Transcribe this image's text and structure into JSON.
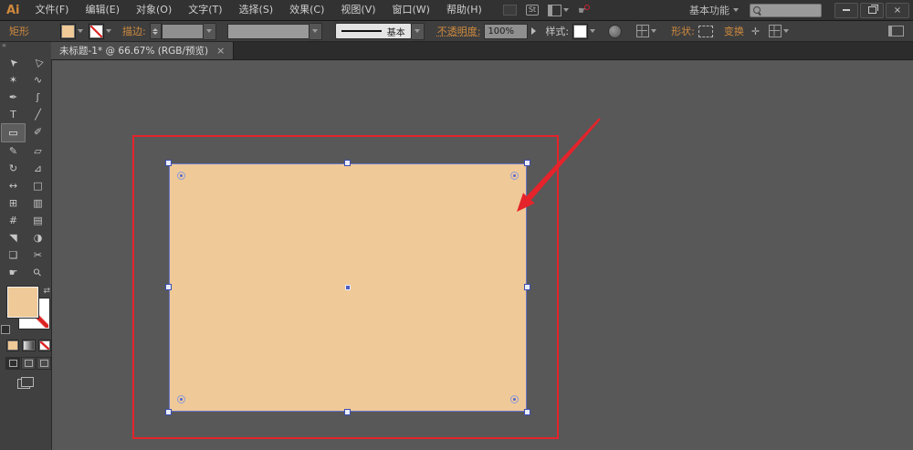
{
  "colors": {
    "accent_orange": "#d08a3e",
    "fill_tan": "#efc997",
    "canvas_gray": "#585858",
    "red": "#e5232b",
    "selection_blue": "#4d5cc0"
  },
  "menubar": {
    "logo": "Ai",
    "items": [
      "文件(F)",
      "编辑(E)",
      "对象(O)",
      "文字(T)",
      "选择(S)",
      "效果(C)",
      "视图(V)",
      "窗口(W)",
      "帮助(H)"
    ],
    "stock_icon_label": "St",
    "workspace": "基本功能",
    "close_glyph": "×"
  },
  "controlbar": {
    "context_label": "矩形",
    "stroke_label": "描边:",
    "stroke_weight": "",
    "brush_label": "基本",
    "opacity_label": "不透明度:",
    "opacity_value": "100%",
    "style_label": "样式:",
    "shape_label": "形状:",
    "transform_label": "变换",
    "transform_icon_glyph": "✛"
  },
  "tabbar": {
    "title": "未标题-1* @ 66.67% (RGB/预览)",
    "close": "×"
  },
  "toolpanel": {
    "collapse_glyph": "«",
    "swap_glyph": "⇄",
    "tools": [
      {
        "name": "selection",
        "glyph": "➤",
        "rot": "-135"
      },
      {
        "name": "direct-selection",
        "glyph": "▷",
        "rot": "-135"
      },
      {
        "name": "magic-wand",
        "glyph": "✶",
        "rot": "0"
      },
      {
        "name": "lasso",
        "glyph": "∿",
        "rot": "0"
      },
      {
        "name": "pen",
        "glyph": "✒",
        "rot": "0"
      },
      {
        "name": "curvature",
        "glyph": "ʃ",
        "rot": "0"
      },
      {
        "name": "type",
        "glyph": "T",
        "rot": "0"
      },
      {
        "name": "line-segment",
        "glyph": "╱",
        "rot": "0"
      },
      {
        "name": "rectangle",
        "glyph": "▭",
        "rot": "0",
        "selected": true
      },
      {
        "name": "paintbrush",
        "glyph": "✐",
        "rot": "0"
      },
      {
        "name": "pencil",
        "glyph": "✎",
        "rot": "0"
      },
      {
        "name": "eraser",
        "glyph": "▱",
        "rot": "0"
      },
      {
        "name": "rotate",
        "glyph": "↻",
        "rot": "0"
      },
      {
        "name": "scale",
        "glyph": "⊿",
        "rot": "0"
      },
      {
        "name": "width",
        "glyph": "↔",
        "rot": "0"
      },
      {
        "name": "free-transform",
        "glyph": "□",
        "rot": "0"
      },
      {
        "name": "shape-builder",
        "glyph": "⊞",
        "rot": "0"
      },
      {
        "name": "graph",
        "glyph": "▥",
        "rot": "0"
      },
      {
        "name": "mesh",
        "glyph": "#",
        "rot": "0"
      },
      {
        "name": "gradient",
        "glyph": "▤",
        "rot": "0"
      },
      {
        "name": "eyedropper",
        "glyph": "◥",
        "rot": "0"
      },
      {
        "name": "blend",
        "glyph": "◑",
        "rot": "0"
      },
      {
        "name": "artboard",
        "glyph": "❏",
        "rot": "0"
      },
      {
        "name": "slice",
        "glyph": "✂",
        "rot": "0"
      },
      {
        "name": "hand",
        "glyph": "☛",
        "rot": "0"
      },
      {
        "name": "zoom",
        "glyph": "⚲",
        "rot": "-45"
      }
    ]
  }
}
